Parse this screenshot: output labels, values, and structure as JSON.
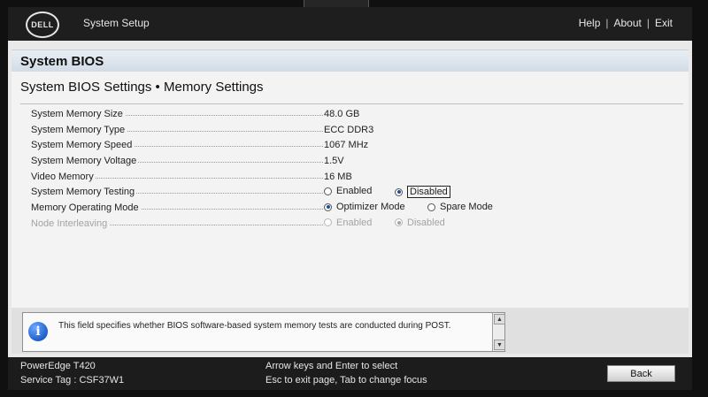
{
  "header": {
    "logo_text": "DELL",
    "title": "System Setup",
    "links": [
      "Help",
      "About",
      "Exit"
    ],
    "separator": "|"
  },
  "panel": {
    "title": "System BIOS",
    "page_title": "System BIOS Settings • Memory Settings"
  },
  "settings": [
    {
      "label": "System Memory Size",
      "value": "48.0 GB"
    },
    {
      "label": "System Memory Type",
      "value": "ECC DDR3"
    },
    {
      "label": "System Memory Speed",
      "value": "1067 MHz"
    },
    {
      "label": "System Memory Voltage",
      "value": "1.5V"
    },
    {
      "label": "Video Memory",
      "value": "16 MB"
    },
    {
      "label": "System Memory Testing",
      "options": [
        "Enabled",
        "Disabled"
      ],
      "selected": "Disabled"
    },
    {
      "label": "Memory Operating Mode",
      "options": [
        "Optimizer Mode",
        "Spare Mode"
      ],
      "selected": "Optimizer Mode"
    },
    {
      "label": "Node Interleaving",
      "options": [
        "Enabled",
        "Disabled"
      ],
      "selected": "Disabled"
    }
  ],
  "help": {
    "icon": "info-icon",
    "icon_glyph": "i",
    "text": "This field specifies whether BIOS software-based system memory tests are conducted during POST."
  },
  "footer": {
    "model": "PowerEdge T420",
    "service_tag": "Service Tag : CSF37W1",
    "hint_line1": "Arrow keys and Enter to select",
    "hint_line2": "Esc to exit page, Tab to change focus",
    "back_label": "Back"
  },
  "colors": {
    "topbar": "#1e1e1e",
    "accent_radio": "#1f4fa0",
    "info_blue": "#1d5fc9"
  }
}
